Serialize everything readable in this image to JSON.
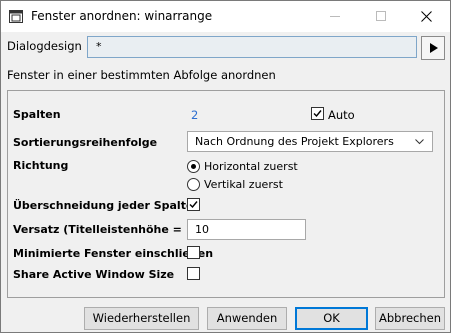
{
  "window": {
    "title": "Fenster anordnen: winarrange"
  },
  "dialog_design": {
    "label": "Dialogdesign",
    "value": "*"
  },
  "description": "Fenster in einer bestimmten Abfolge anordnen",
  "fields": {
    "columns": {
      "label": "Spalten",
      "value": "2",
      "auto_label": "Auto",
      "auto_checked": true
    },
    "sort_order": {
      "label": "Sortierungsreihenfolge",
      "selected": "Nach Ordnung des Projekt Explorers"
    },
    "direction": {
      "label": "Richtung",
      "options": [
        {
          "label": "Horizontal zuerst",
          "selected": true
        },
        {
          "label": "Vertikal zuerst",
          "selected": false
        }
      ]
    },
    "overlap": {
      "label": "Überschneidung jeder Spalte",
      "checked": true
    },
    "offset": {
      "label": "Versatz (Titelleistenhöhe = 10)",
      "value": "10"
    },
    "minimized": {
      "label": "Minimierte Fenster einschließen",
      "checked": false
    },
    "share_active": {
      "label": "Share Active Window Size",
      "checked": false
    }
  },
  "buttons": {
    "restore": "Wiederherstellen",
    "apply": "Anwenden",
    "ok": "OK",
    "cancel": "Abbrechen"
  },
  "colors": {
    "accent": "#0078d7",
    "value_blue": "#2e6fd0"
  }
}
